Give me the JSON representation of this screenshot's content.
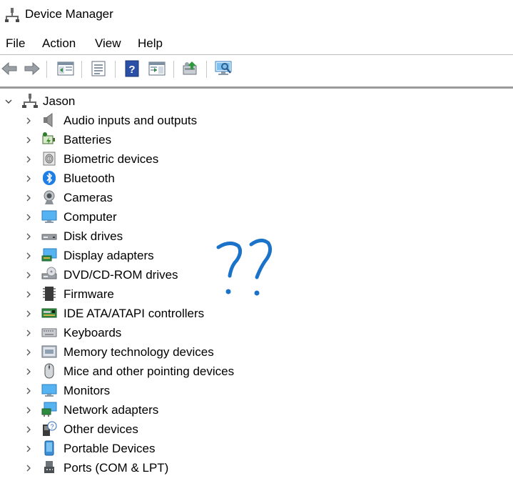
{
  "window": {
    "title": "Device Manager"
  },
  "menu": [
    "File",
    "Action",
    "View",
    "Help"
  ],
  "tree": {
    "root": "Jason",
    "items": [
      {
        "label": "Audio inputs and outputs",
        "icon": "speaker-icon"
      },
      {
        "label": "Batteries",
        "icon": "battery-icon"
      },
      {
        "label": "Biometric devices",
        "icon": "fingerprint-icon"
      },
      {
        "label": "Bluetooth",
        "icon": "bluetooth-icon"
      },
      {
        "label": "Cameras",
        "icon": "camera-icon"
      },
      {
        "label": "Computer",
        "icon": "computer-icon"
      },
      {
        "label": "Disk drives",
        "icon": "disk-drive-icon"
      },
      {
        "label": "Display adapters",
        "icon": "display-adapter-icon"
      },
      {
        "label": "DVD/CD-ROM drives",
        "icon": "dvd-drive-icon"
      },
      {
        "label": "Firmware",
        "icon": "firmware-chip-icon"
      },
      {
        "label": "IDE ATA/ATAPI controllers",
        "icon": "ide-controller-icon"
      },
      {
        "label": "Keyboards",
        "icon": "keyboard-icon"
      },
      {
        "label": "Memory technology devices",
        "icon": "memory-device-icon"
      },
      {
        "label": "Mice and other pointing devices",
        "icon": "mouse-icon"
      },
      {
        "label": "Monitors",
        "icon": "monitor-icon"
      },
      {
        "label": "Network adapters",
        "icon": "network-adapter-icon"
      },
      {
        "label": "Other devices",
        "icon": "unknown-device-icon"
      },
      {
        "label": "Portable Devices",
        "icon": "portable-device-icon"
      },
      {
        "label": "Ports (COM & LPT)",
        "icon": "port-icon"
      }
    ]
  },
  "annotation": {
    "text": "??",
    "color": "#1a73c9"
  }
}
